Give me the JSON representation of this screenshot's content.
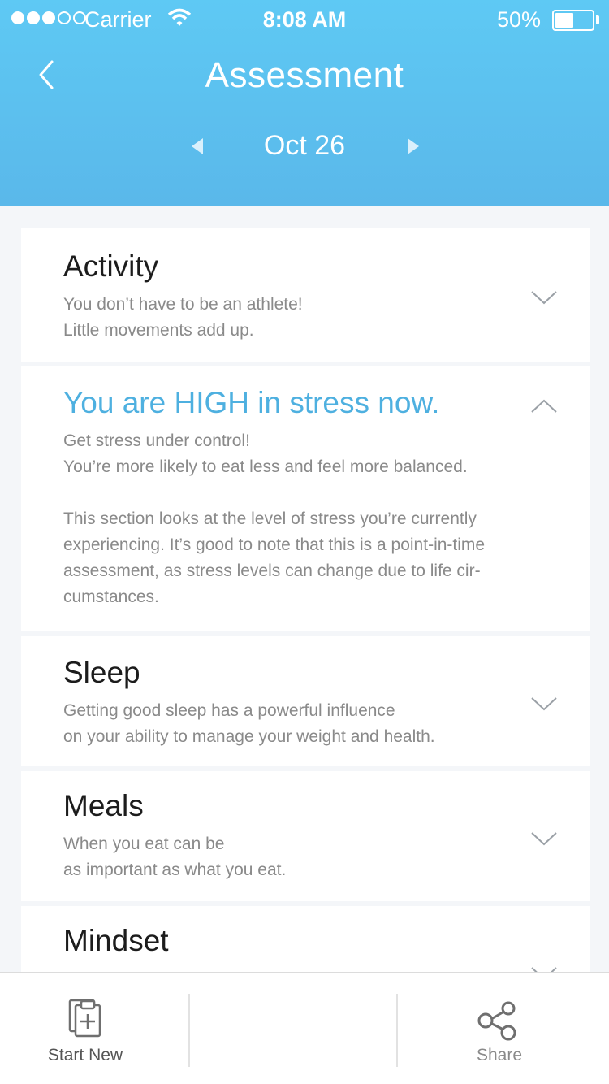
{
  "status_bar": {
    "carrier": "Carrier",
    "time": "8:08 AM",
    "battery": "50%",
    "battery_level": 0.5
  },
  "header": {
    "title": "Assessment",
    "date": "Oct 26",
    "back_icon": "chevron-left-icon",
    "prev_icon": "triangle-left-icon",
    "next_icon": "triangle-right-icon"
  },
  "sections": [
    {
      "title": "Activity",
      "description": "You don’t have to be an athlete!\nLittle movements add up.",
      "expanded": false
    },
    {
      "title": "You are HIGH in stress now.",
      "description": "Get stress under control!\nYou’re more likely to eat less and feel more balanced.",
      "detail": "This section looks at the level of stress you’re currently\nexperiencing. It’s good to note that this is a point-in-time\nassessment, as stress levels can change due to life cir-\ncumstances.",
      "expanded": true
    },
    {
      "title": "Sleep",
      "description": "Getting good sleep has a powerful influence\non your ability to manage your weight and  health.",
      "expanded": false
    },
    {
      "title": "Meals",
      "description": "When you eat can be\nas important as what you eat.",
      "expanded": false
    },
    {
      "title": "Mindset",
      "description": "",
      "expanded": false
    }
  ],
  "bottom_bar": {
    "start_new": "Start New",
    "share": "Share",
    "start_new_icon": "clipboard-plus-icon",
    "share_icon": "share-icon"
  },
  "colors": {
    "header_top": "#5ec9f4",
    "header_bottom": "#5ab8ea",
    "highlight": "#4eb0e0",
    "background": "#f4f6f9"
  }
}
